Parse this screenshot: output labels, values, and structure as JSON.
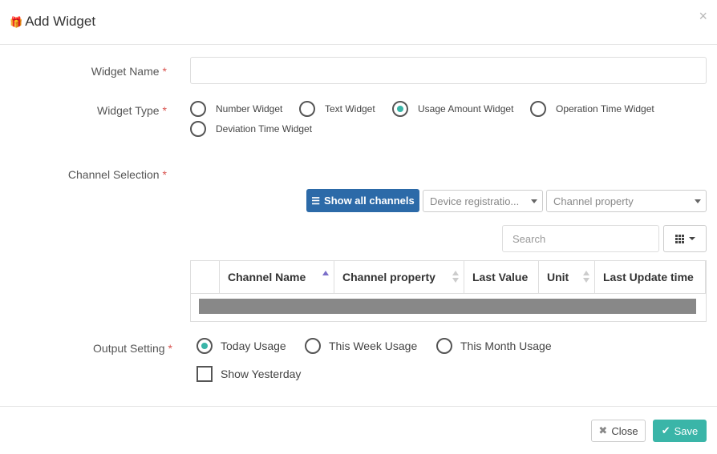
{
  "modal": {
    "title": "Add Widget",
    "close_glyph": "×"
  },
  "icons": {
    "title_icon": "gift-icon",
    "close": "close-icon",
    "show_channels": "list-icon",
    "columns": "grid-icon",
    "close_button": "times-icon",
    "save_button": "check-icon"
  },
  "form": {
    "widget_name": {
      "label": "Widget Name",
      "required": "*",
      "value": ""
    },
    "widget_type": {
      "label": "Widget Type",
      "required": "*",
      "options": [
        {
          "label": "Number Widget",
          "checked": false
        },
        {
          "label": "Text Widget",
          "checked": false
        },
        {
          "label": "Usage Amount Widget",
          "checked": true
        },
        {
          "label": "Operation Time Widget",
          "checked": false
        },
        {
          "label": "Deviation Time Widget",
          "checked": false
        }
      ]
    },
    "channel_selection": {
      "label": "Channel Selection",
      "required": "*",
      "show_all_label": "Show all channels",
      "device_select": "Device registratio...",
      "property_select": "Channel property",
      "search_placeholder": "Search",
      "table": {
        "columns": [
          "Channel Name",
          "Channel property",
          "Last Value",
          "Unit",
          "Last Update time"
        ],
        "sorted_column": "Channel Name"
      }
    },
    "output_setting": {
      "label": "Output Setting",
      "required": "*",
      "options": [
        {
          "label": "Today Usage",
          "checked": true
        },
        {
          "label": "This Week Usage",
          "checked": false
        },
        {
          "label": "This Month Usage",
          "checked": false
        }
      ],
      "show_yesterday": {
        "label": "Show Yesterday",
        "checked": false
      }
    }
  },
  "footer": {
    "close_label": "Close",
    "save_label": "Save"
  },
  "colors": {
    "primary": "#2c6aa8",
    "accent": "#3ab5a8",
    "required": "#d9534f"
  }
}
